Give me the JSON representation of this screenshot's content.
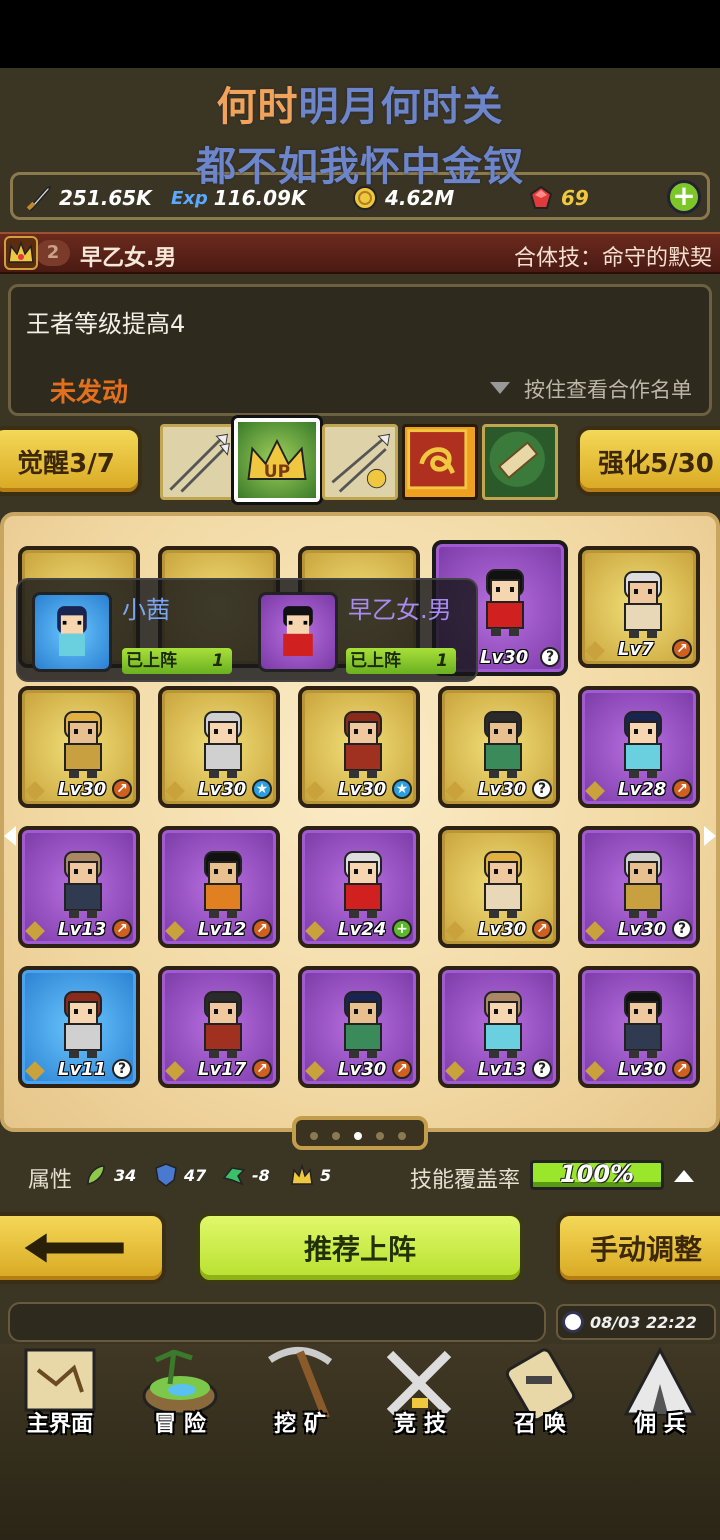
{
  "lyric": {
    "line1_highlight": "何时",
    "line1_rest": "明月何时关",
    "line2": "都不如我怀中金钗"
  },
  "resources": {
    "power": "251.65K",
    "exp_label": "Exp",
    "exp": "116.09K",
    "gold": "4.62M",
    "gems": "69"
  },
  "combo": {
    "rank_number": "2",
    "name": "早乙女.男",
    "skill": "合体技：命守的默契"
  },
  "info": {
    "effect": "王者等级提高4",
    "status": "未发动",
    "hint": "按住查看合作名单"
  },
  "awaken": {
    "label": "觉醒3/7"
  },
  "strengthen": {
    "label": "强化5/30"
  },
  "skill_up_label": "UP",
  "popup": {
    "heroes": [
      {
        "name": "小茜",
        "tag": "已上阵",
        "count": "1"
      },
      {
        "name": "早乙女.男",
        "tag": "已上阵",
        "count": "1"
      }
    ]
  },
  "heroes": [
    {
      "level": "Lv30",
      "rarity": "purple",
      "badge": "?"
    },
    {
      "level": "Lv7",
      "rarity": "gold",
      "badge": "↗"
    },
    {
      "level": "Lv30",
      "rarity": "gold",
      "badge": "↗"
    },
    {
      "level": "Lv30",
      "rarity": "gold",
      "badge": "★"
    },
    {
      "level": "Lv30",
      "rarity": "gold",
      "badge": "★"
    },
    {
      "level": "Lv30",
      "rarity": "gold",
      "badge": "?"
    },
    {
      "level": "Lv28",
      "rarity": "purple",
      "badge": "↗"
    },
    {
      "level": "Lv13",
      "rarity": "purple",
      "badge": "↗"
    },
    {
      "level": "Lv12",
      "rarity": "purple",
      "badge": "↗"
    },
    {
      "level": "Lv24",
      "rarity": "purple",
      "badge": "+"
    },
    {
      "level": "Lv30",
      "rarity": "gold",
      "badge": "↗"
    },
    {
      "level": "Lv30",
      "rarity": "purple",
      "badge": "?"
    },
    {
      "level": "Lv11",
      "rarity": "blue",
      "badge": "?"
    },
    {
      "level": "Lv17",
      "rarity": "purple",
      "badge": "↗"
    },
    {
      "level": "Lv30",
      "rarity": "purple",
      "badge": "↗"
    },
    {
      "level": "Lv13",
      "rarity": "purple",
      "badge": "?"
    },
    {
      "level": "Lv30",
      "rarity": "purple",
      "badge": "↗"
    }
  ],
  "page_dots": {
    "count": 5,
    "active": 3
  },
  "attributes": {
    "label": "属性",
    "nature": "34",
    "defense": "47",
    "dragon": "-8",
    "king": "5"
  },
  "coverage": {
    "label": "技能覆盖率",
    "value": "100%",
    "fraction": 1.0
  },
  "buttons": {
    "recommend": "推荐上阵",
    "manual": "手动调整"
  },
  "clock": "08/03 22:22",
  "nav": [
    {
      "label": "主界面",
      "icon": "map-scroll-icon"
    },
    {
      "label": "冒 险",
      "icon": "island-icon"
    },
    {
      "label": "挖 矿",
      "icon": "pickaxe-icon"
    },
    {
      "label": "竞 技",
      "icon": "crossed-swords-icon"
    },
    {
      "label": "召 唤",
      "icon": "scroll-key-icon"
    },
    {
      "label": "佣 兵",
      "icon": "tent-icon"
    }
  ],
  "colors": {
    "accent_gold": "#f0c840",
    "accent_green": "#b8e02e",
    "highlight_orange": "#f2a35a",
    "lyric_blue": "#6d86c9"
  }
}
